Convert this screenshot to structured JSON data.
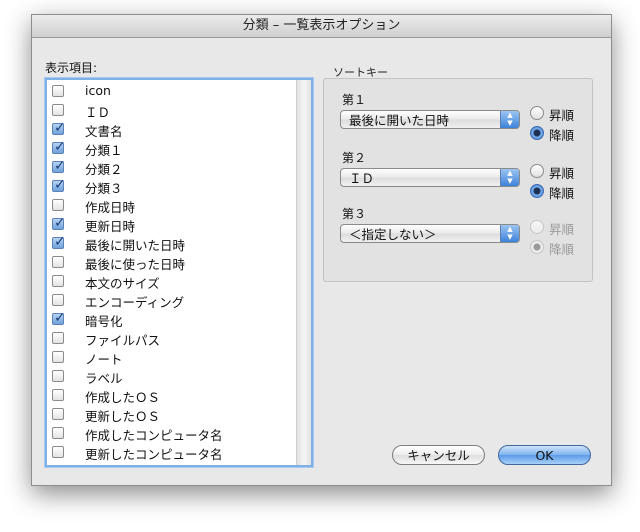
{
  "window": {
    "title": "分類 – 一覧表示オプション"
  },
  "columns": {
    "label": "表示項目:",
    "items": [
      {
        "label": "icon",
        "checked": false
      },
      {
        "label": "ＩＤ",
        "checked": false
      },
      {
        "label": "文書名",
        "checked": true
      },
      {
        "label": "分類１",
        "checked": true
      },
      {
        "label": "分類２",
        "checked": true
      },
      {
        "label": "分類３",
        "checked": true
      },
      {
        "label": "作成日時",
        "checked": false
      },
      {
        "label": "更新日時",
        "checked": true
      },
      {
        "label": "最後に開いた日時",
        "checked": true
      },
      {
        "label": "最後に使った日時",
        "checked": false
      },
      {
        "label": "本文のサイズ",
        "checked": false
      },
      {
        "label": "エンコーディング",
        "checked": false
      },
      {
        "label": "暗号化",
        "checked": true
      },
      {
        "label": "ファイルパス",
        "checked": false
      },
      {
        "label": "ノート",
        "checked": false
      },
      {
        "label": "ラベル",
        "checked": false
      },
      {
        "label": "作成したＯＳ",
        "checked": false
      },
      {
        "label": "更新したＯＳ",
        "checked": false
      },
      {
        "label": "作成したコンピュータ名",
        "checked": false
      },
      {
        "label": "更新したコンピュータ名",
        "checked": false
      }
    ]
  },
  "sort": {
    "legend": "ソートキー",
    "levels": [
      {
        "label": "第１",
        "value": "最後に開いた日時",
        "ascending_label": "昇順",
        "descending_label": "降順",
        "selected": "descending",
        "enabled": true
      },
      {
        "label": "第２",
        "value": "ＩＤ",
        "ascending_label": "昇順",
        "descending_label": "降順",
        "selected": "descending",
        "enabled": true
      },
      {
        "label": "第３",
        "value": "＜指定しない＞",
        "ascending_label": "昇順",
        "descending_label": "降順",
        "selected": "descending",
        "enabled": false
      }
    ]
  },
  "buttons": {
    "cancel": "キャンセル",
    "ok": "OK"
  }
}
